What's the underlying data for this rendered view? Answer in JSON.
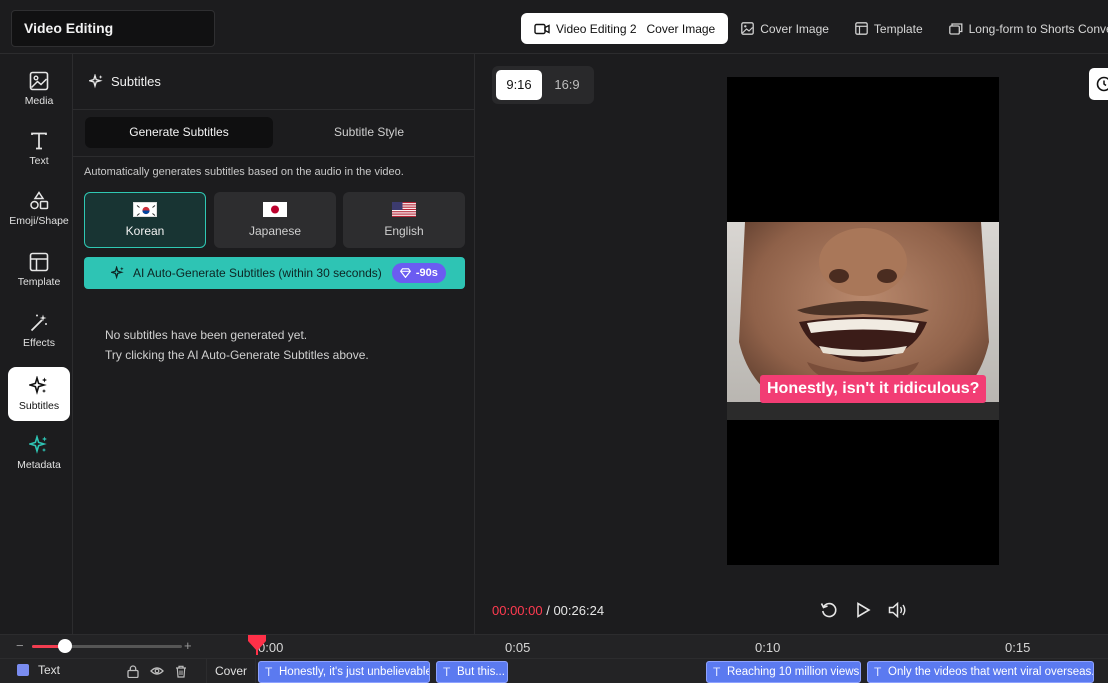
{
  "header": {
    "project_title": "Video Editing",
    "nav": [
      {
        "label": "Video Editing 2",
        "sub": "Cover Image",
        "icon": "video-camera-icon",
        "active": true
      },
      {
        "label": "Cover Image",
        "icon": "image-icon"
      },
      {
        "label": "Template",
        "icon": "template-icon"
      },
      {
        "label": "Long-form to Shorts Conversion",
        "icon": "layers-icon"
      }
    ]
  },
  "sidebar": {
    "items": [
      {
        "label": "Media",
        "icon": "image-icon"
      },
      {
        "label": "Text",
        "icon": "text-icon"
      },
      {
        "label": "Emoji/Shape",
        "icon": "shapes-icon"
      },
      {
        "label": "Template",
        "icon": "template-icon"
      },
      {
        "label": "Effects",
        "icon": "magic-wand-icon"
      },
      {
        "label": "Subtitles",
        "icon": "sparkle-icon",
        "active": true
      },
      {
        "label": "Metadata",
        "icon": "sparkle-teal-icon"
      }
    ]
  },
  "panel": {
    "title": "Subtitles",
    "tabs": [
      {
        "label": "Generate Subtitles",
        "active": true
      },
      {
        "label": "Subtitle Style"
      }
    ],
    "hint": "Automatically generates subtitles based on the audio in the video.",
    "languages": [
      {
        "label": "Korean",
        "flag": "korea-flag-icon",
        "selected": true
      },
      {
        "label": "Japanese",
        "flag": "japan-flag-icon"
      },
      {
        "label": "English",
        "flag": "usa-flag-icon"
      }
    ],
    "generate_button": "AI Auto-Generate Subtitles (within 30 seconds)",
    "cost_badge": "-90s",
    "empty_line1": "No subtitles have been generated yet.",
    "empty_line2": "Try clicking the AI Auto-Generate Subtitles above."
  },
  "preview": {
    "ratios": [
      {
        "label": "9:16",
        "active": true
      },
      {
        "label": "16:9"
      }
    ],
    "caption": "Honestly, isn't it ridiculous?",
    "current_time": "00:00:00",
    "separator": " / ",
    "total_time": "00:26:24"
  },
  "timeline": {
    "zoom_minus": "−",
    "zoom_plus": "+",
    "zoom_level": 0.22,
    "ruler": [
      "0:00",
      "0:05",
      "0:10",
      "0:15"
    ],
    "track_label": "Text",
    "cover_label": "Cover",
    "clips": [
      "Honestly, it's just unbelievable...",
      "But this...",
      "Reaching 10 million views",
      "Only the videos that went viral overseas."
    ],
    "clip_glyph": "T"
  },
  "colors": {
    "accent_teal": "#2ec4b4",
    "caption_pink": "#f23d74",
    "time_red": "#ff3b50",
    "clip_blue": "#5b7af0",
    "badge_purple": "#6b5cf1"
  }
}
